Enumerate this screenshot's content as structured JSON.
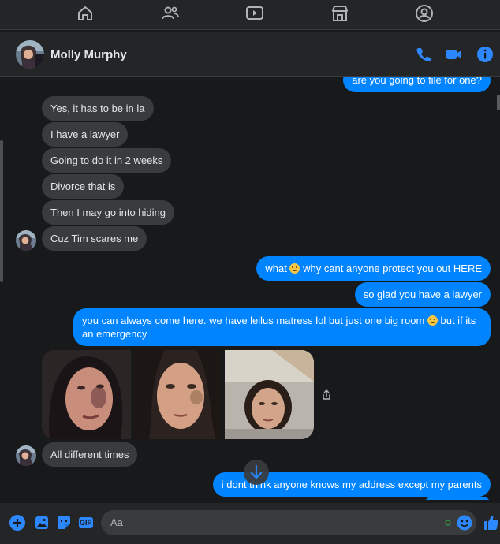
{
  "topnav": {
    "icons": [
      "home-icon",
      "people-icon",
      "video-icon",
      "marketplace-icon",
      "groups-icon"
    ]
  },
  "header": {
    "name": "Molly Murphy",
    "actions": [
      "phone-icon",
      "video-call-icon",
      "info-icon"
    ]
  },
  "messages": {
    "partial_out": "are you going to file for one?",
    "in1": "Yes, it has to be in la",
    "in2": "I have a lawyer",
    "in3": "Going to do it in 2 weeks",
    "in4": "Divorce that is",
    "in5": "Then I may go into hiding",
    "in6": "Cuz Tim scares me",
    "out1_a": "what ",
    "out1_b": " why cant anyone protect you out HERE",
    "out2": "so glad you have a lawyer",
    "out3_a": "you can always come here. we have leilus matress lol but just one big room ",
    "out3_b": " but if its an emergency",
    "in7": "All different times",
    "out4": "i dont think anyone knows my address except my parents"
  },
  "composer": {
    "placeholder": "Aa",
    "icons": [
      "add-icon",
      "photo-icon",
      "sticker-icon",
      "gif-icon",
      "emoji-icon",
      "like-icon"
    ],
    "gif_label": "GIF"
  },
  "colors": {
    "outgoing": "#0084ff",
    "incoming": "#3a3b3c",
    "background": "#18191a",
    "accent": "#2d88ff"
  }
}
